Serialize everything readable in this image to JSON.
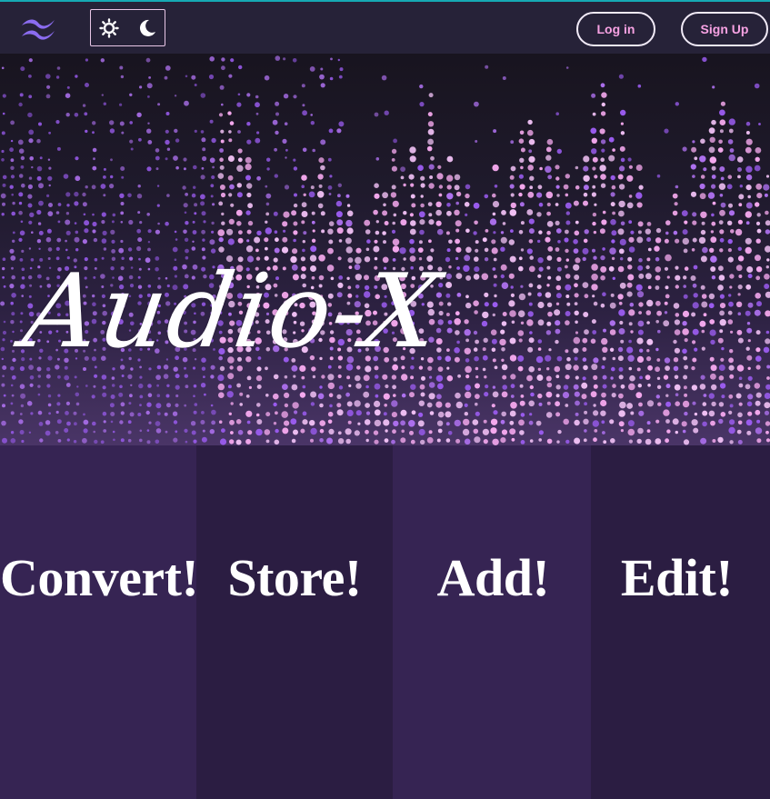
{
  "navbar": {
    "logo_icon": "wind-wave-logo-icon",
    "theme_toggle": {
      "light_icon": "sun-icon",
      "dark_icon": "moon-icon"
    },
    "login_label": "Log in",
    "signup_label": "Sign Up"
  },
  "hero": {
    "title": "Audio-X",
    "background": "music-equalizer-dots"
  },
  "features": [
    {
      "label": "Convert!"
    },
    {
      "label": "Store!"
    },
    {
      "label": "Add!"
    },
    {
      "label": "Edit!"
    }
  ],
  "colors": {
    "navbar_bg": "#262238",
    "accent_pink": "#f7a2e3",
    "logo_purple": "#8b6cf0",
    "feature_light": "#362453",
    "feature_dark": "#2b1d42"
  }
}
